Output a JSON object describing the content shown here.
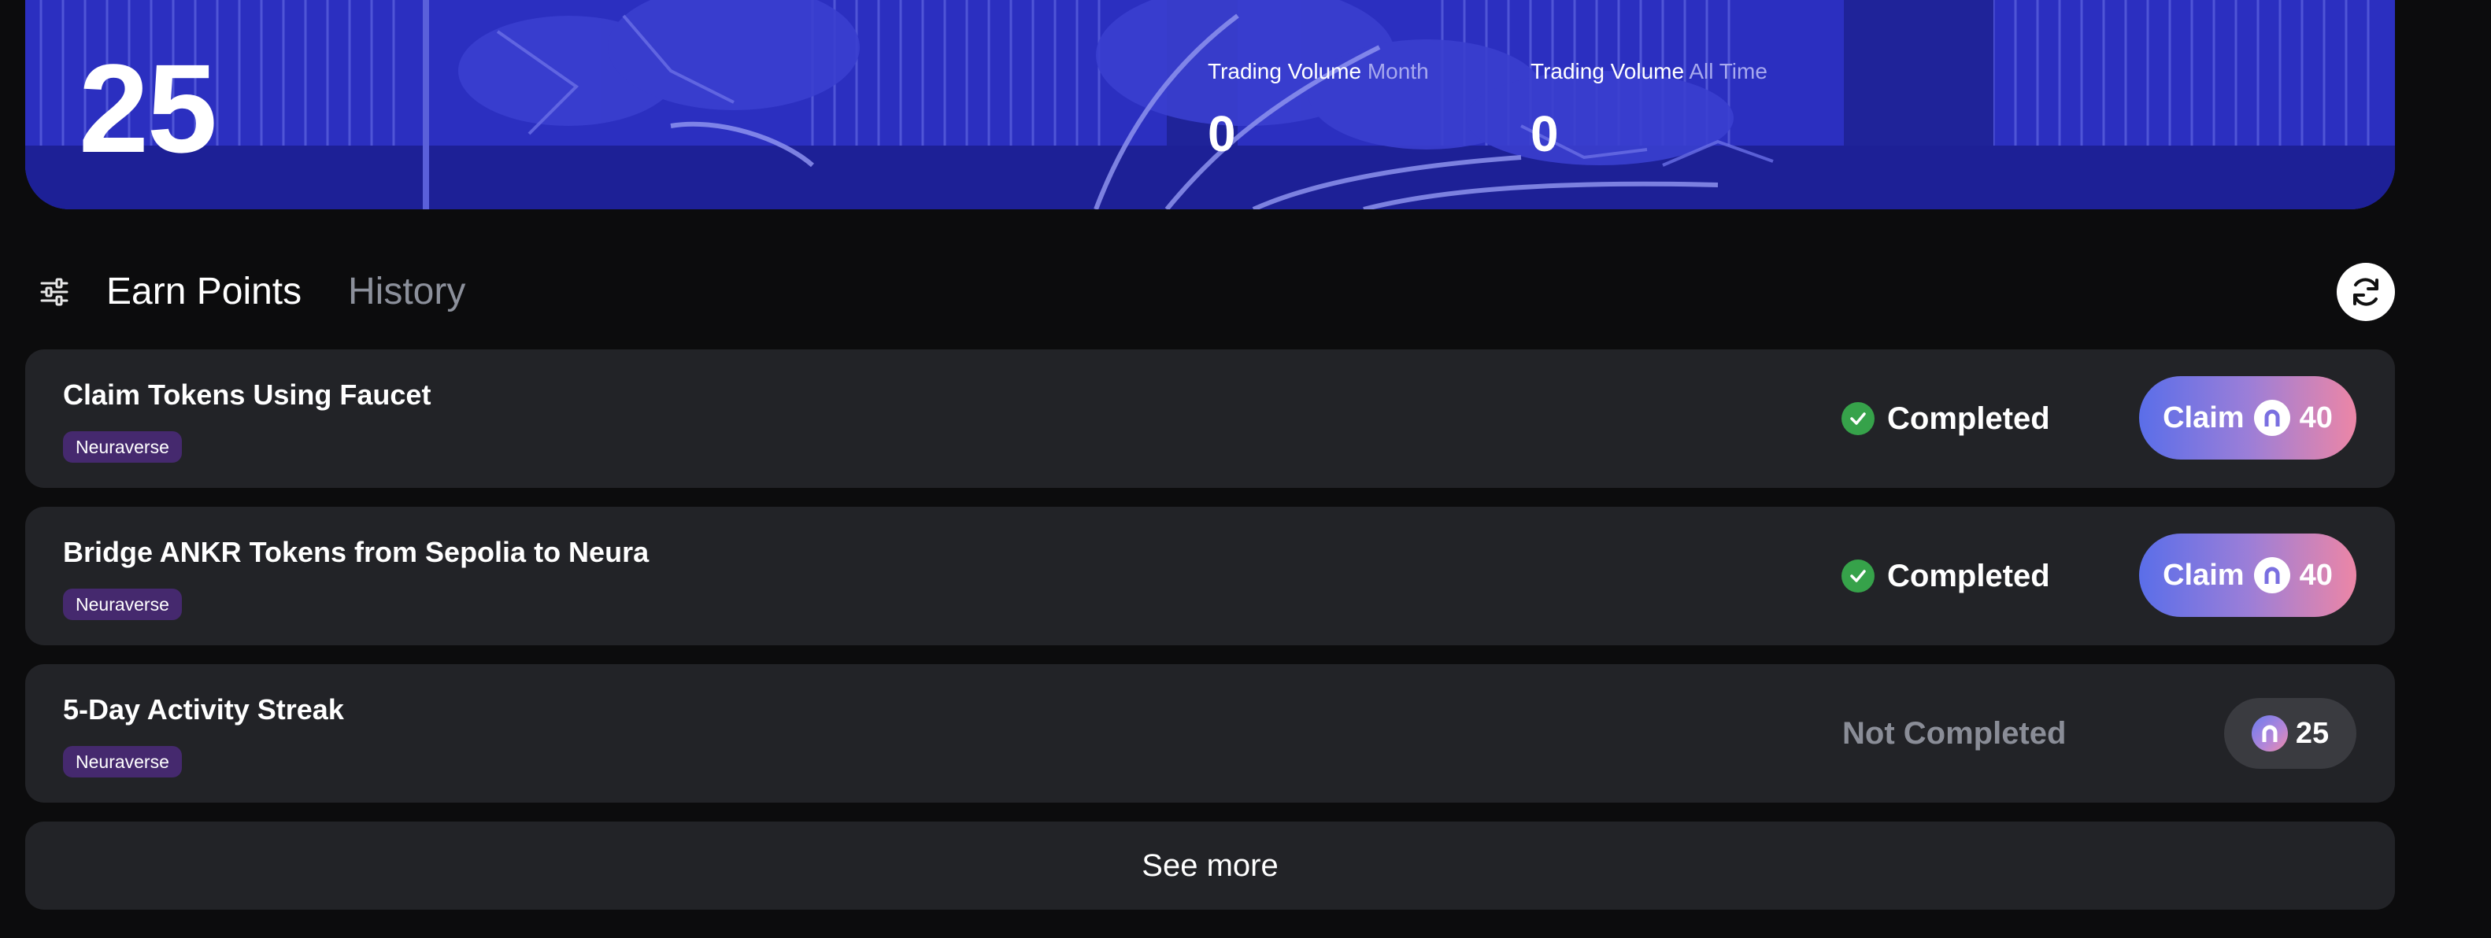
{
  "hero": {
    "points": "25",
    "stats": [
      {
        "label": "Trading Volume",
        "period": "Month",
        "value": "0"
      },
      {
        "label": "Trading Volume",
        "period": "All Time",
        "value": "0"
      }
    ]
  },
  "tabs": {
    "active": "Earn Points",
    "inactive": "History"
  },
  "tasks": [
    {
      "title": "Claim Tokens Using Faucet",
      "tag": "Neuraverse",
      "status": "Completed",
      "action": "Claim",
      "reward": "40"
    },
    {
      "title": "Bridge ANKR Tokens from Sepolia to Neura",
      "tag": "Neuraverse",
      "status": "Completed",
      "action": "Claim",
      "reward": "40"
    },
    {
      "title": "5-Day Activity Streak",
      "tag": "Neuraverse",
      "status": "Not Completed",
      "reward": "25"
    }
  ],
  "see_more": "See more",
  "icons": {
    "filter": "sliders-icon",
    "refresh": "refresh-icon",
    "check": "check-circle-icon",
    "coin": "neura-coin-icon"
  },
  "colors": {
    "background": "#0c0c0d",
    "hero": "#2a2eb8",
    "card": "#222327",
    "tag": "#45296e",
    "success": "#36a24a",
    "claim_gradient_start": "#5a6ee9",
    "claim_gradient_end": "#ec86a6"
  }
}
